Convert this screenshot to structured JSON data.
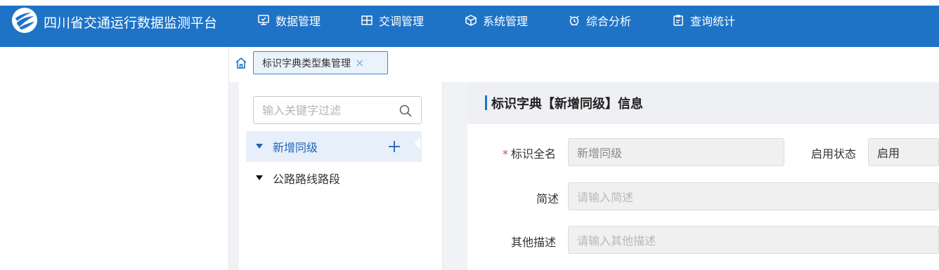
{
  "app": {
    "title": "四川省交通运行数据监测平台"
  },
  "nav": [
    {
      "label": "数据管理",
      "icon": "monitor-check-icon"
    },
    {
      "label": "交调管理",
      "icon": "grid-table-icon"
    },
    {
      "label": "系统管理",
      "icon": "cube-icon"
    },
    {
      "label": "综合分析",
      "icon": "alarm-clock-icon"
    },
    {
      "label": "查询统计",
      "icon": "clipboard-icon"
    }
  ],
  "tabs": [
    {
      "label": "标识字典类型集管理",
      "close": "×"
    }
  ],
  "tree": {
    "filter_placeholder": "输入关键字过滤",
    "nodes": [
      {
        "label": "新增同级",
        "active": true
      },
      {
        "label": "公路路线路段",
        "active": false
      }
    ]
  },
  "form": {
    "title": "标识字典【新增同级】信息",
    "required_mark": "*",
    "fields": {
      "full_name": {
        "label": "标识全名",
        "value": "新增同级"
      },
      "status": {
        "label": "启用状态",
        "value": "启用"
      },
      "brief": {
        "label": "简述",
        "placeholder": "请输入简述"
      },
      "other": {
        "label": "其他描述",
        "placeholder": "请输入其他描述"
      }
    }
  },
  "colors": {
    "topbar": "#1f73c7",
    "accent": "#3b86d6",
    "active_tree_bg": "#e7effb",
    "required": "#e04545"
  }
}
